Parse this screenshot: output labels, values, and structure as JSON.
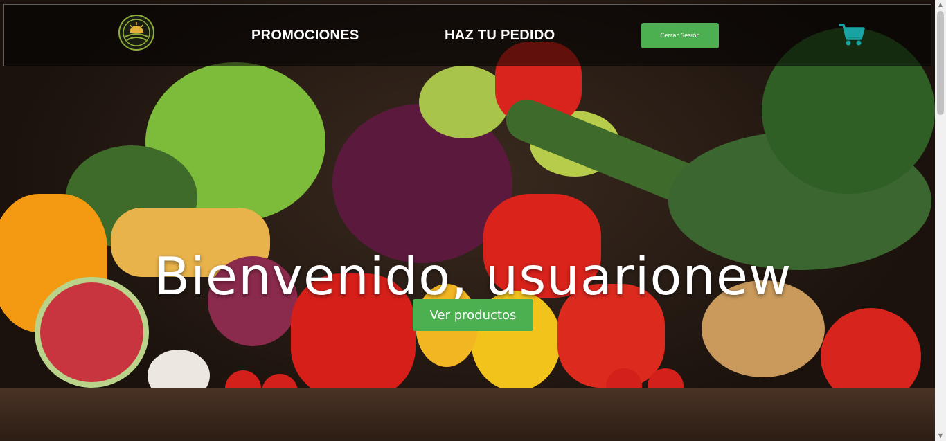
{
  "nav": {
    "promotions_label": "PROMOCIONES",
    "order_label": "HAZ TU PEDIDO",
    "logout_label": "Cerrar Sesión"
  },
  "hero": {
    "welcome_text": "Bienvenido, usuarionew",
    "cta_label": "Ver productos"
  },
  "icons": {
    "logo": "sunrise-fields-logo-icon",
    "cart": "shopping-cart-icon",
    "scroll_up": "arrow-up-icon",
    "scroll_down": "arrow-down-icon"
  },
  "colors": {
    "accent_green": "#4caf50",
    "cart_teal": "#1aa3a3",
    "navbar_bg": "rgba(0,0,0,0.55)"
  }
}
